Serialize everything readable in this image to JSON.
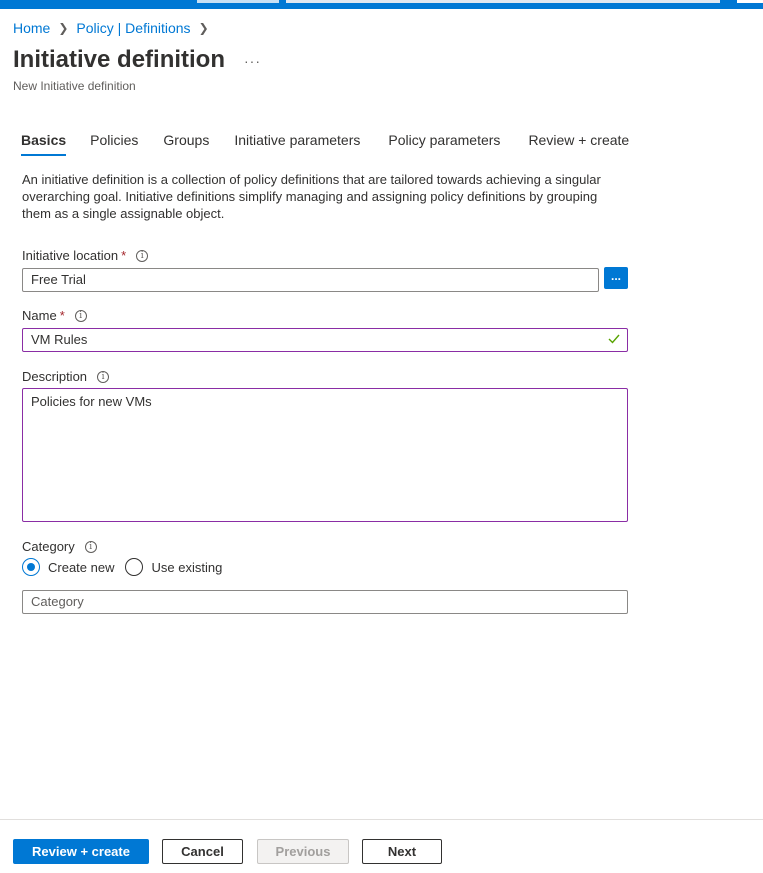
{
  "breadcrumb": {
    "items": [
      "Home",
      "Policy | Definitions"
    ],
    "separator": ">"
  },
  "header": {
    "title": "Initiative definition",
    "more": "···",
    "subtitle": "New Initiative definition"
  },
  "tabs": [
    {
      "label": "Basics",
      "active": true
    },
    {
      "label": "Policies",
      "active": false
    },
    {
      "label": "Groups",
      "active": false
    },
    {
      "label": "Initiative parameters",
      "active": false
    },
    {
      "label": "Policy parameters",
      "active": false
    },
    {
      "label": "Review + create",
      "active": false
    }
  ],
  "intro": "An initiative definition is a collection of policy definitions that are tailored towards achieving a singular overarching goal. Initiative definitions simplify managing and assigning policy definitions by grouping them as a single assignable object.",
  "form": {
    "location": {
      "label": "Initiative location",
      "required": "*",
      "value": "Free Trial",
      "browse_label": "..."
    },
    "name": {
      "label": "Name",
      "required": "*",
      "value": "VM Rules"
    },
    "description": {
      "label": "Description",
      "value": "Policies for new VMs"
    },
    "category": {
      "label": "Category",
      "options": [
        {
          "label": "Create new",
          "selected": true
        },
        {
          "label": "Use existing",
          "selected": false
        }
      ],
      "placeholder": "Category"
    }
  },
  "footer": {
    "review_create": "Review + create",
    "cancel": "Cancel",
    "previous": "Previous",
    "next": "Next"
  },
  "colors": {
    "accent": "#0078d4",
    "required": "#a4262c",
    "focus_border": "#8a2da5",
    "valid_check": "#57a300"
  }
}
